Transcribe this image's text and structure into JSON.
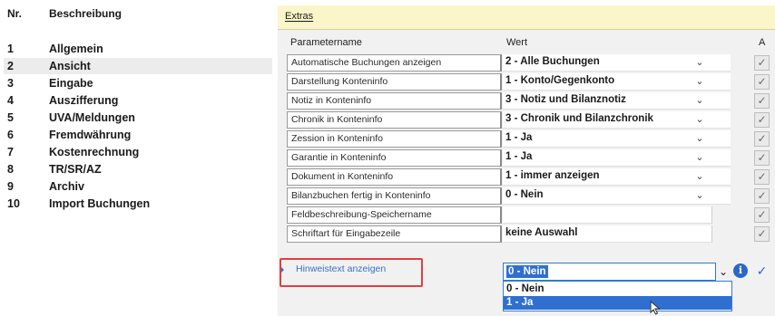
{
  "nav": {
    "header_nr": "Nr.",
    "header_desc": "Beschreibung",
    "items": [
      {
        "nr": "1",
        "label": "Allgemein"
      },
      {
        "nr": "2",
        "label": "Ansicht"
      },
      {
        "nr": "3",
        "label": "Eingabe"
      },
      {
        "nr": "4",
        "label": "Auszifferung"
      },
      {
        "nr": "5",
        "label": "UVA/Meldungen"
      },
      {
        "nr": "6",
        "label": "Fremdwährung"
      },
      {
        "nr": "7",
        "label": "Kostenrechnung"
      },
      {
        "nr": "8",
        "label": "TR/SR/AZ"
      },
      {
        "nr": "9",
        "label": "Archiv"
      },
      {
        "nr": "10",
        "label": "Import Buchungen"
      }
    ],
    "selected_index": 1
  },
  "panel": {
    "title": "Extras",
    "col_param": "Parametername",
    "col_value": "Wert",
    "col_a": "A"
  },
  "params": [
    {
      "name": "Automatische Buchungen anzeigen",
      "value": "2 - Alle Buchungen",
      "dropdown": true
    },
    {
      "name": "Darstellung Konteninfo",
      "value": "1 - Konto/Gegenkonto",
      "dropdown": true
    },
    {
      "name": "Notiz in Konteninfo",
      "value": "3 - Notiz und Bilanznotiz",
      "dropdown": true
    },
    {
      "name": "Chronik in Konteninfo",
      "value": "3 - Chronik und Bilanzchronik",
      "dropdown": true
    },
    {
      "name": "Zession in Konteninfo",
      "value": "1 - Ja",
      "dropdown": true
    },
    {
      "name": "Garantie in Konteninfo",
      "value": "1 - Ja",
      "dropdown": true
    },
    {
      "name": "Dokument in Konteninfo",
      "value": "1 - immer anzeigen",
      "dropdown": true
    },
    {
      "name": "Bilanzbuchen fertig in Konteninfo",
      "value": "0 - Nein",
      "dropdown": true
    },
    {
      "name": "Feldbeschreibung-Speichername",
      "value": "",
      "dropdown": false
    },
    {
      "name": "Schriftart für Eingabezeile",
      "value": "keine Auswahl",
      "dropdown": false
    }
  ],
  "active_param": {
    "name": "Hinweistext anzeigen",
    "value": "0 - Nein",
    "options": [
      "0 - Nein",
      "1 - Ja"
    ],
    "highlighted_option": 1
  },
  "icons": {
    "dropdown": "chevron-down-icon",
    "check": "checkmark-icon",
    "info": "info-icon",
    "cursor": "mouse-cursor-icon"
  },
  "colors": {
    "panel_header": "#fbf6c9",
    "selection_blue": "#2f6fd0",
    "highlight_outline": "#e04040",
    "info_blue": "#2b66c9"
  }
}
